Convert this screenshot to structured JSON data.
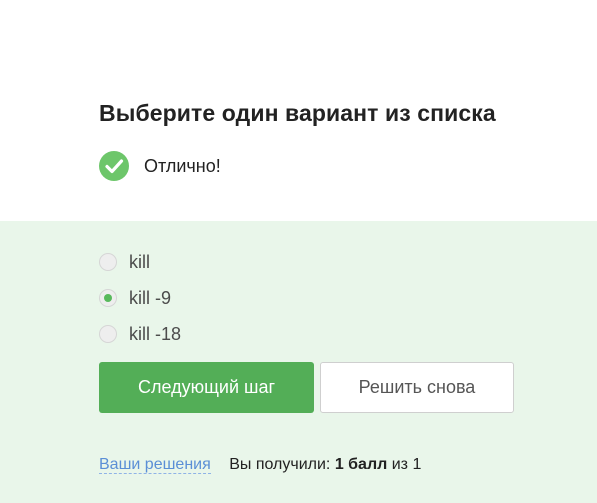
{
  "question": {
    "title": "Выберите один вариант из списка"
  },
  "status": {
    "icon": "check-circle-icon",
    "icon_color": "#6dc66a",
    "text": "Отлично!"
  },
  "options": [
    {
      "label": "kill",
      "selected": false
    },
    {
      "label": "kill -9",
      "selected": true
    },
    {
      "label": "kill -18",
      "selected": false
    }
  ],
  "actions": {
    "next_label": "Следующий шаг",
    "retry_label": "Решить снова"
  },
  "footer": {
    "solutions_link": "Ваши решения",
    "score_prefix": "Вы получили:",
    "score_value": "1 балл",
    "score_suffix": "из 1"
  },
  "colors": {
    "accent_green": "#53ae57",
    "feedback_bg": "#e9f6ea",
    "link_blue": "#5b8fd6"
  }
}
